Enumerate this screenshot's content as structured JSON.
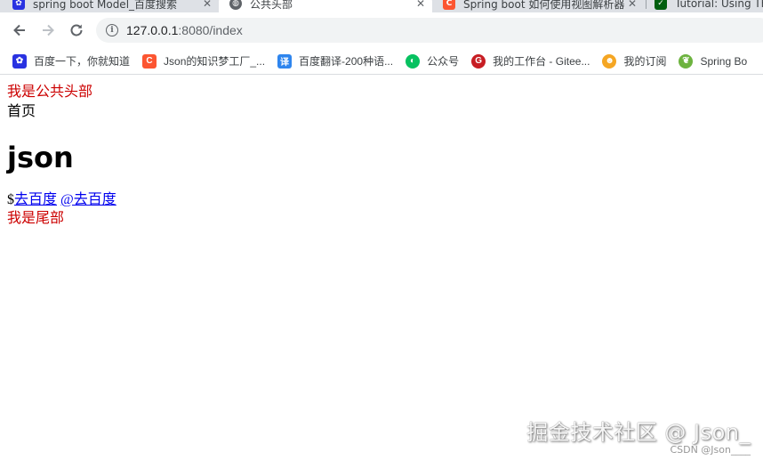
{
  "tabs": [
    {
      "title": "spring boot Model_百度搜索",
      "favicon": "baidu-paw-icon",
      "active": false
    },
    {
      "title": "公共头部",
      "favicon": "globe-icon",
      "active": true
    },
    {
      "title": "Spring boot 如何使用视图解析器",
      "favicon": "csdn-c-icon",
      "active": false
    },
    {
      "title": "Tutorial: Using Th",
      "favicon": "thymeleaf-leaf-icon",
      "active": false
    }
  ],
  "tab_close_glyph": "✕",
  "address": {
    "host": "127.0.0.1",
    "path": ":8080/index"
  },
  "bookmarks": [
    {
      "label": "百度一下，你就知道",
      "icon": "baidu-paw-icon",
      "color": "#2932e1"
    },
    {
      "label": "Json的知识梦工厂_...",
      "icon": "csdn-c-icon",
      "color": "#fc5531"
    },
    {
      "label": "百度翻译-200种语...",
      "icon": "translate-icon",
      "color": "#2e85ee"
    },
    {
      "label": "公众号",
      "icon": "wechat-icon",
      "color": "#07c160"
    },
    {
      "label": "我的工作台 - Gitee...",
      "icon": "gitee-icon",
      "color": "#c71d23"
    },
    {
      "label": "我的订阅",
      "icon": "subscription-icon",
      "color": "#f5a623"
    },
    {
      "label": "Spring Bo",
      "icon": "spring-leaf-icon",
      "color": "#6db33f"
    }
  ],
  "page": {
    "header_text": "我是公共头部",
    "nav_text": "首页",
    "heading": "json",
    "link_prefix": "$",
    "link1": "去百度",
    "link2": "@去百度",
    "footer_text": "我是尾部"
  },
  "watermark": {
    "main": "掘金技术社区 @ Json_",
    "small": "CSDN @Json____"
  },
  "colors": {
    "red_text": "#cc0000",
    "link": "#0000ee"
  }
}
